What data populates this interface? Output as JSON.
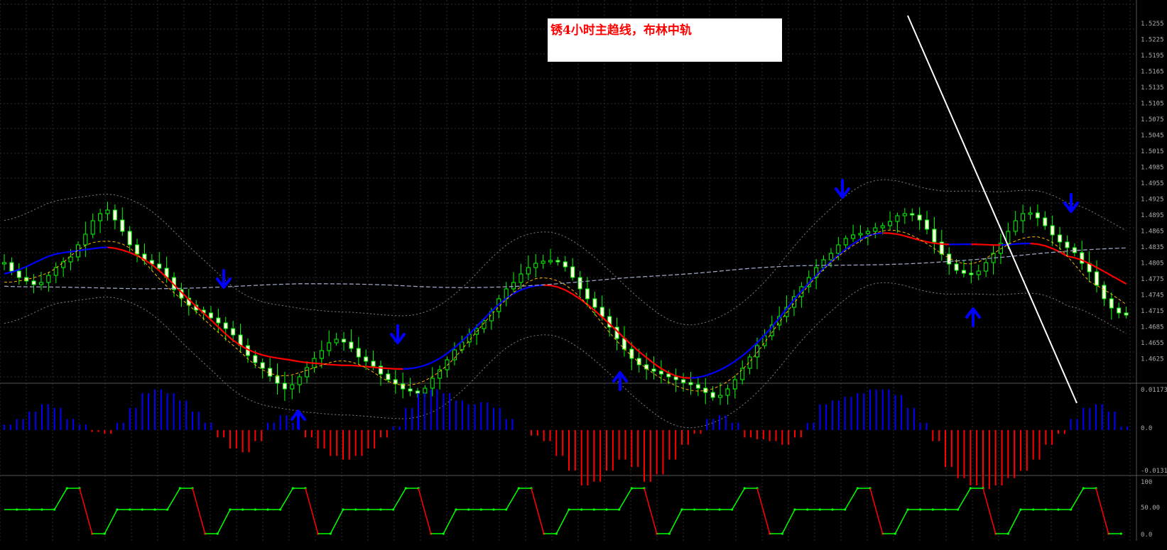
{
  "annotation": {
    "text": "锈4小时主趋线，布林中轨"
  },
  "colors": {
    "background": "#000000",
    "grid": "#2b2b2b",
    "candle": "#00ff00",
    "candle_body": "#ffffe0",
    "ma_up": "#0000ff",
    "ma_down": "#ff0000",
    "ma_fast": "#ffb400",
    "ma_slow": "#9aa0c0",
    "bollinger": "#808080",
    "hist_pos": "#0000ff",
    "hist_neg": "#ff0000",
    "osc_up": "#00ff00",
    "osc_down": "#ff0000",
    "arrow": "#0000ff",
    "trendline": "#ffffff"
  },
  "chart_data": {
    "type": "candlestick",
    "closes": [
      370,
      382,
      391,
      396,
      401,
      398,
      388,
      377,
      369,
      362,
      345,
      330,
      311,
      301,
      296,
      310,
      326,
      345,
      358,
      367,
      372,
      378,
      391,
      408,
      420,
      430,
      437,
      441,
      448,
      455,
      463,
      472,
      487,
      501,
      511,
      519,
      530,
      540,
      548,
      542,
      531,
      518,
      505,
      494,
      483,
      478,
      482,
      491,
      503,
      509,
      516,
      527,
      535,
      541,
      548,
      551,
      554,
      547,
      533,
      521,
      507,
      493,
      482,
      471,
      463,
      452,
      439,
      421,
      407,
      398,
      386,
      377,
      371,
      368,
      367,
      369,
      376,
      391,
      407,
      421,
      433,
      446,
      461,
      477,
      492,
      505,
      514,
      520,
      523,
      527,
      531,
      535,
      539,
      542,
      547,
      553,
      560,
      557,
      548,
      535,
      519,
      503,
      487,
      473,
      458,
      446,
      433,
      418,
      404,
      391,
      377,
      366,
      357,
      345,
      336,
      331,
      329,
      326,
      321,
      318,
      312,
      304,
      301,
      303,
      310,
      323,
      341,
      358,
      372,
      381,
      385,
      387,
      382,
      370,
      357,
      343,
      326,
      311,
      301,
      300,
      307,
      318,
      331,
      341,
      349,
      356,
      371,
      383,
      402,
      421,
      434,
      441,
      444
    ],
    "series": [
      {
        "values_hist": [
          0.15,
          0.3,
          0.5,
          0.7,
          0.6,
          0.3,
          0.15,
          -0.05,
          -0.1,
          0.2,
          0.6,
          1,
          1.1,
          1,
          0.8,
          0.5,
          0.2,
          -0.2,
          -0.5,
          -0.6,
          -0.3,
          0.2,
          0.4,
          0.2,
          -0.2,
          -0.5,
          -0.7,
          -0.8,
          -0.7,
          -0.5,
          -0.2,
          0.1,
          0.6,
          1,
          1.1,
          1,
          0.8,
          0.7,
          0.75,
          0.6,
          0.3,
          0,
          -0.15,
          -0.3,
          -0.7,
          -1.1,
          -1.5,
          -1.4,
          -1.1,
          -0.8,
          -1,
          -1.4,
          -1.2,
          -0.8,
          -0.4,
          -0.1,
          0.3,
          0.4,
          0.2,
          -0.2,
          -0.25,
          -0.3,
          -0.4,
          -0.2,
          0.2,
          0.7,
          0.8,
          0.9,
          1,
          1.1,
          1.1,
          0.95,
          0.6,
          0.2,
          -0.3,
          -1,
          -1.3,
          -1.5,
          -1.6,
          -1.5,
          -1.3,
          -1.1,
          -0.8,
          -0.4,
          -0.1,
          0.3,
          0.6,
          0.7,
          0.5,
          0.1
        ]
      }
    ],
    "y_ticks": [
      "1.5255",
      "1.5225",
      "1.5195",
      "1.5165",
      "1.5135",
      "1.5105",
      "1.5075",
      "1.5045",
      "1.5015",
      "1.4985",
      "1.4955",
      "1.4925",
      "1.4895",
      "1.4865",
      "1.4835",
      "1.4805",
      "1.4775",
      "1.4745",
      "1.4715",
      "1.4685",
      "1.4655",
      "1.4625"
    ],
    "macd_ticks": [
      "0.01173",
      "0.0",
      "-0.01316"
    ],
    "osc_ticks": [
      "100",
      "50.00",
      "0.0"
    ],
    "arrows_down": [
      315,
      560,
      1186,
      1508
    ],
    "arrows_up": [
      420,
      873,
      1370
    ]
  }
}
